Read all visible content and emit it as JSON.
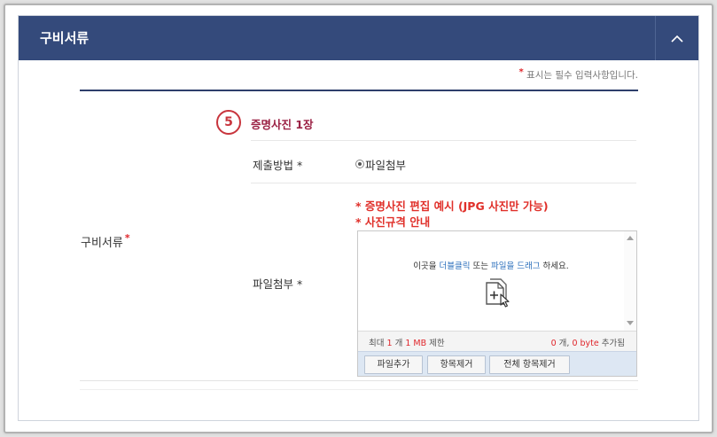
{
  "panel": {
    "title": "구비서류",
    "toggle_icon": "chevron-up-icon"
  },
  "required_note": {
    "mark": "*",
    "text": " 표시는 필수 입력사항입니다."
  },
  "section": {
    "label": "구비서류",
    "required_mark": "*"
  },
  "item": {
    "number": "5",
    "title": "증명사진 1장"
  },
  "submit_method": {
    "label": "제출방법 *",
    "options": [
      {
        "label": "파일첨부",
        "selected": true
      }
    ]
  },
  "attachment": {
    "label": "파일첨부 *",
    "notices": [
      "* 증명사진 편집 예시 (JPG 사진만 가능)",
      "* 사진규격 안내"
    ],
    "dropzone": {
      "text_1": "이곳을 ",
      "link_1": "더블클릭",
      "text_2": " 또는 ",
      "link_2": "파일을 드래그",
      "text_3": " 하세요.",
      "icon": "file-add-icon"
    },
    "limit": {
      "prefix": "최대 ",
      "count": "1",
      "count_unit": " 개 ",
      "size": "1 MB",
      "suffix": " 제한"
    },
    "added": {
      "count": "0",
      "count_unit": " 개, ",
      "size": "0 byte",
      "suffix": " 추가됨"
    },
    "buttons": {
      "add": "파일추가",
      "remove": "항목제거",
      "remove_all": "전체 항목제거"
    }
  },
  "colors": {
    "header": "#344a7b",
    "accent_line": "#2e3f6b",
    "required": "#e0262b",
    "item_title": "#9b2245",
    "link": "#2a6ebb",
    "button_bar": "#dde7f3"
  }
}
